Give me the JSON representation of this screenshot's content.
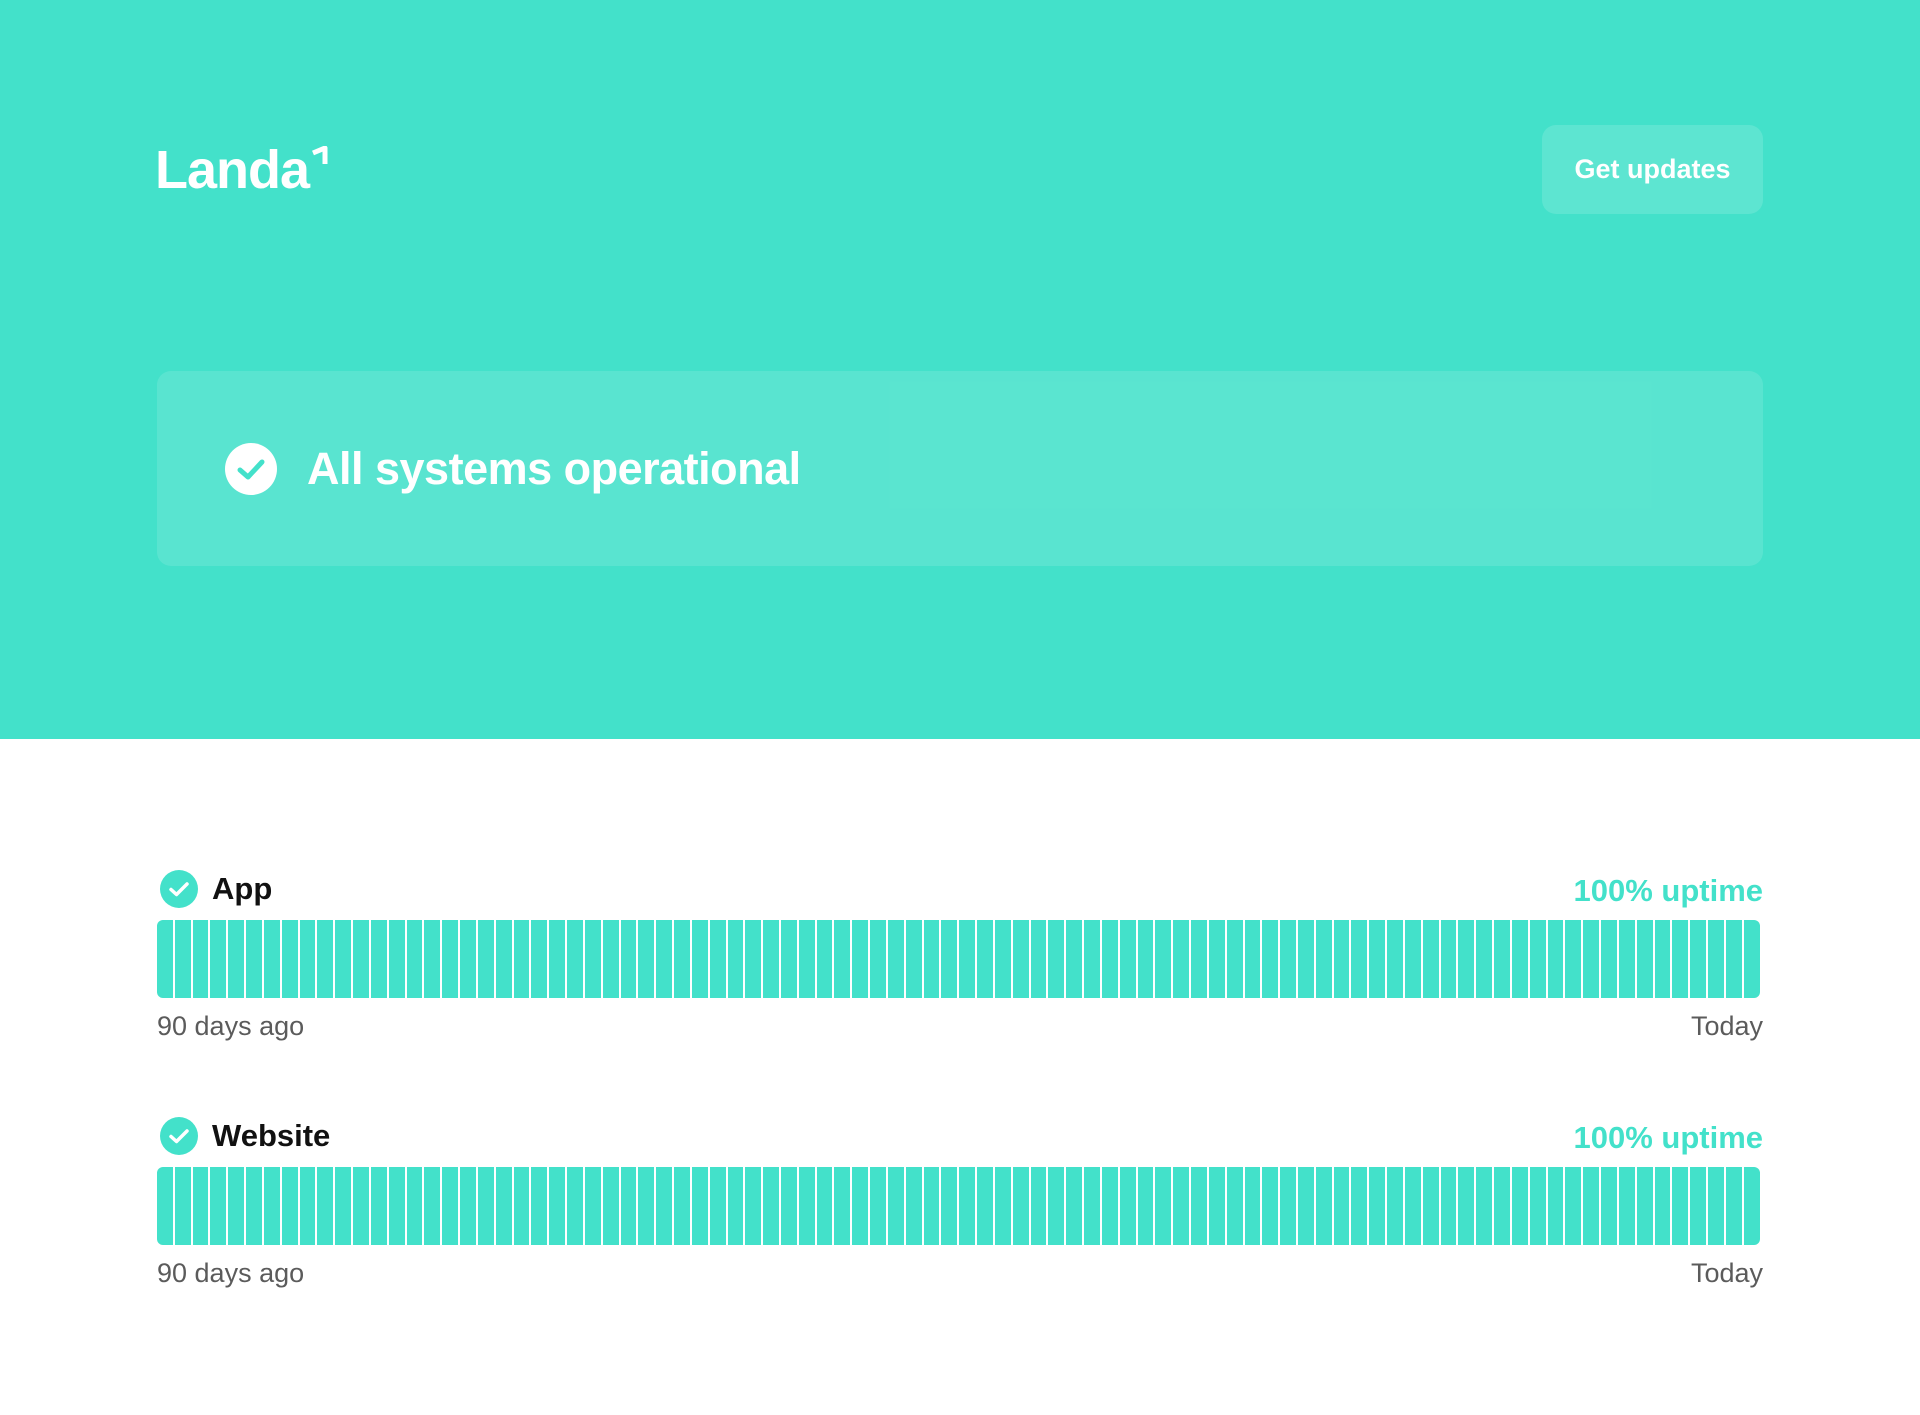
{
  "brand": {
    "name": "Landa",
    "color": "#43e1ca"
  },
  "header": {
    "updates_button": "Get updates"
  },
  "status": {
    "icon": "check-circle-icon",
    "message": "All systems operational"
  },
  "components": [
    {
      "name": "App",
      "status_icon": "check-circle-icon",
      "uptime": "100% uptime",
      "uptime_percent": 100,
      "days": 90,
      "range_start": "90 days ago",
      "range_end": "Today"
    },
    {
      "name": "Website",
      "status_icon": "check-circle-icon",
      "uptime": "100% uptime",
      "uptime_percent": 100,
      "days": 90,
      "range_start": "90 days ago",
      "range_end": "Today"
    }
  ]
}
